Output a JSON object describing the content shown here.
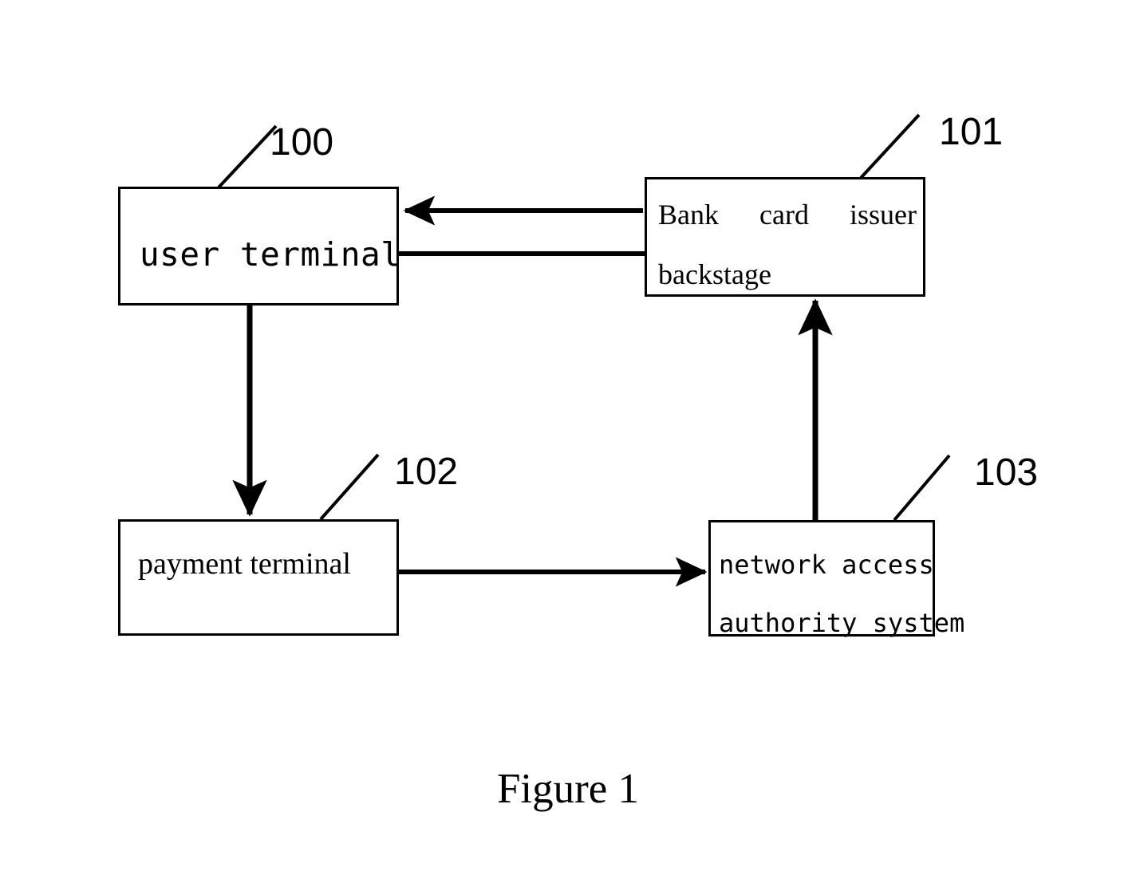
{
  "figure": {
    "caption": "Figure 1",
    "nodes": [
      {
        "ref": "100",
        "label": "user terminal",
        "name": "user-terminal"
      },
      {
        "ref": "101",
        "label_line1_word1": "Bank",
        "label_line1_word2": "card",
        "label_line1_word3": "issuer",
        "label_line2": "backstage",
        "name": "bank-card-issuer-backstage"
      },
      {
        "ref": "102",
        "label": "payment terminal",
        "name": "payment-terminal"
      },
      {
        "ref": "103",
        "label_line1": "network access",
        "label_line2": "authority system",
        "name": "network-access-authority-system"
      }
    ],
    "connectors": [
      {
        "name": "bank-to-user-terminal",
        "from": "101",
        "to": "100",
        "direction": "left"
      },
      {
        "name": "user-terminal-to-bank",
        "from": "100",
        "to": "101",
        "direction": "right"
      },
      {
        "name": "user-terminal-to-payment-terminal",
        "from": "100",
        "to": "102",
        "direction": "down"
      },
      {
        "name": "payment-terminal-to-network-access",
        "from": "102",
        "to": "103",
        "direction": "right"
      },
      {
        "name": "network-access-to-bank",
        "from": "103",
        "to": "101",
        "direction": "up"
      }
    ],
    "colors": {
      "stroke": "#000000",
      "background": "#ffffff"
    }
  }
}
